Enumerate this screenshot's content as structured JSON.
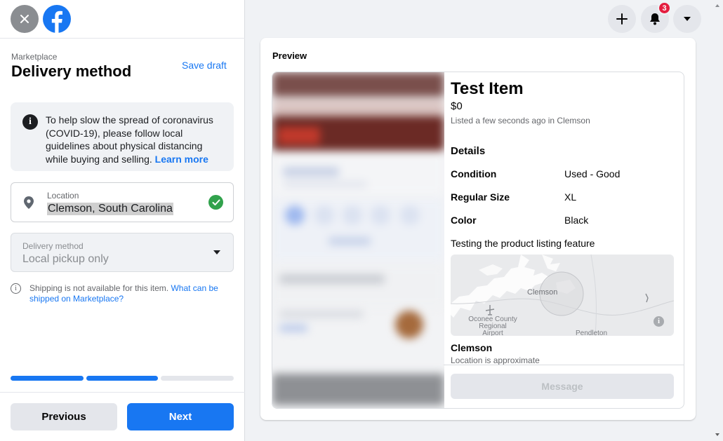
{
  "header": {
    "notification_count": "3"
  },
  "sidebar": {
    "breadcrumb": "Marketplace",
    "title": "Delivery method",
    "save_draft": "Save draft",
    "covid_notice": "To help slow the spread of coronavirus (COVID-19), please follow local guidelines about physical distancing while buying and selling.",
    "covid_link": "Learn more",
    "location": {
      "label": "Location",
      "value": "Clemson, South Carolina"
    },
    "delivery": {
      "label": "Delivery method",
      "value": "Local pickup only"
    },
    "shipping_note": "Shipping is not available for this item.",
    "shipping_link": "What can be shipped on Marketplace?",
    "progress_steps": 3,
    "progress_completed": 2,
    "previous_label": "Previous",
    "next_label": "Next"
  },
  "preview": {
    "label": "Preview",
    "title": "Test Item",
    "price": "$0",
    "listed": "Listed a few seconds ago in Clemson",
    "details_heading": "Details",
    "attributes": [
      {
        "key": "Condition",
        "value": "Used - Good"
      },
      {
        "key": "Regular Size",
        "value": "XL"
      },
      {
        "key": "Color",
        "value": "Black"
      }
    ],
    "description": "Testing the product listing feature",
    "map": {
      "city": "Clemson",
      "airport": "Oconee County Regional Airport",
      "town": "Pendleton"
    },
    "location_name": "Clemson",
    "location_note": "Location is approximate",
    "message_label": "Message"
  },
  "colors": {
    "accent": "#1877f2",
    "success": "#31a24c",
    "badge": "#e41e3f"
  }
}
